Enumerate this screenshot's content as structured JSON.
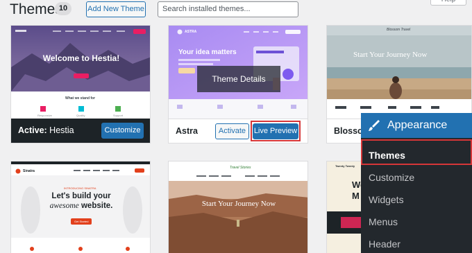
{
  "header": {
    "title": "Themes",
    "count": "10",
    "add_new_label": "Add New Theme",
    "search_placeholder": "Search installed themes...",
    "help_label": "Help"
  },
  "themes": [
    {
      "name": "Hestia",
      "active_prefix": "Active:",
      "active": true,
      "primary_action": "Customize",
      "screenshot": {
        "hero_title": "Welcome to Hestia!",
        "section_title": "What we stand for",
        "features": [
          "Responsive",
          "Quality",
          "Support"
        ]
      }
    },
    {
      "name": "Astra",
      "active": false,
      "overlay_label": "Theme Details",
      "secondary_action": "Activate",
      "primary_action": "Live Preview",
      "screenshot": {
        "brand": "ASTRA",
        "hero_title": "Your idea matters"
      }
    },
    {
      "name": "Blossom Travel",
      "active": false,
      "screenshot": {
        "brand": "Blossom Travel",
        "hero_title": "Start Your Journey Now"
      }
    },
    {
      "name": "Sinatra",
      "active": false,
      "screenshot": {
        "brand": "Sinatra",
        "tagline": "INTRODUCING SINATRA",
        "hero_title_1": "Let's build your",
        "hero_title_2_em": "awesome",
        "hero_title_2_rest": "website.",
        "cta": "Get Started"
      }
    },
    {
      "name": "Travel Stories",
      "active": false,
      "screenshot": {
        "brand": "Travel Stories",
        "hero_title": "Start Your Journey Now"
      }
    },
    {
      "name": "Twenty Twenty",
      "active": false,
      "screenshot": {
        "brand": "Twenty Twenty",
        "hero_title_1": "We",
        "hero_title_2": "M"
      }
    }
  ],
  "appearance_menu": {
    "title": "Appearance",
    "icon": "paintbrush-icon",
    "items": [
      "Themes",
      "Customize",
      "Widgets",
      "Menus",
      "Header"
    ],
    "current": "Themes"
  },
  "colors": {
    "accent": "#2271b1",
    "highlight": "#d63638",
    "menu_bg": "#23282d"
  }
}
